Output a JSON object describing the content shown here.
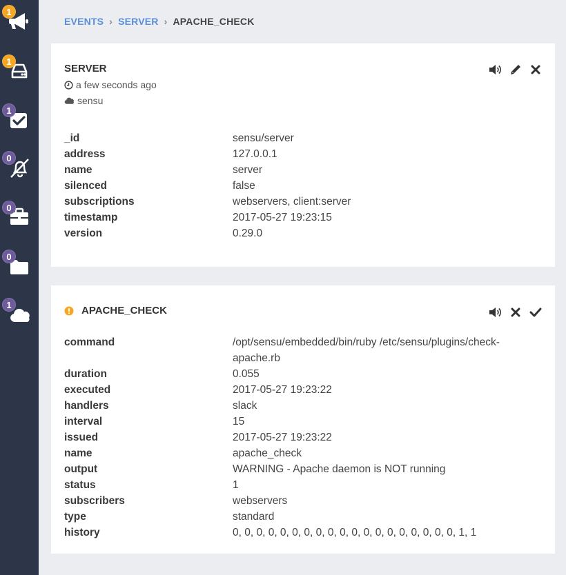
{
  "sidebar": {
    "items": [
      {
        "name": "events",
        "icon": "megaphone-icon",
        "badge": "1",
        "badge_color": "#f5a623"
      },
      {
        "name": "clients",
        "icon": "hard-drive-icon",
        "badge": "1",
        "badge_color": "#f5a623"
      },
      {
        "name": "checks",
        "icon": "checkbox-icon",
        "badge": "1",
        "badge_color": "#6e5b9b"
      },
      {
        "name": "silenced",
        "icon": "bell-slash-icon",
        "badge": "0",
        "badge_color": "#6e5b9b"
      },
      {
        "name": "stashes",
        "icon": "briefcase-icon",
        "badge": "0",
        "badge_color": "#6e5b9b"
      },
      {
        "name": "aggregates",
        "icon": "folder-icon",
        "badge": "0",
        "badge_color": "#6e5b9b"
      },
      {
        "name": "datacenters",
        "icon": "cloud-icon",
        "badge": "1",
        "badge_color": "#6e5b9b"
      }
    ]
  },
  "breadcrumb": {
    "events": "EVENTS",
    "server": "SERVER",
    "current": "APACHE_CHECK"
  },
  "client": {
    "title": "SERVER",
    "time": "a few seconds ago",
    "datacenter": "sensu",
    "fields": [
      {
        "key": "_id",
        "value": "sensu/server"
      },
      {
        "key": "address",
        "value": "127.0.0.1"
      },
      {
        "key": "name",
        "value": "server"
      },
      {
        "key": "silenced",
        "value": "false"
      },
      {
        "key": "subscriptions",
        "value": "webservers, client:server"
      },
      {
        "key": "timestamp",
        "value": "2017-05-27 19:23:15"
      },
      {
        "key": "version",
        "value": "0.29.0"
      }
    ]
  },
  "check": {
    "title": "APACHE_CHECK",
    "status_color": "#f5a623",
    "fields": [
      {
        "key": "command",
        "value": "/opt/sensu/embedded/bin/ruby /etc/sensu/plugins/check-apache.rb"
      },
      {
        "key": "duration",
        "value": "0.055"
      },
      {
        "key": "executed",
        "value": "2017-05-27 19:23:22"
      },
      {
        "key": "handlers",
        "value": "slack"
      },
      {
        "key": "interval",
        "value": "15"
      },
      {
        "key": "issued",
        "value": "2017-05-27 19:23:22"
      },
      {
        "key": "name",
        "value": "apache_check"
      },
      {
        "key": "output",
        "value": "WARNING - Apache daemon is NOT running"
      },
      {
        "key": "status",
        "value": "1"
      },
      {
        "key": "subscribers",
        "value": "webservers"
      },
      {
        "key": "type",
        "value": "standard"
      },
      {
        "key": "history",
        "value": "0, 0, 0, 0, 0, 0, 0, 0, 0, 0, 0, 0, 0, 0, 0, 0, 0, 0, 0, 1, 1"
      }
    ]
  }
}
